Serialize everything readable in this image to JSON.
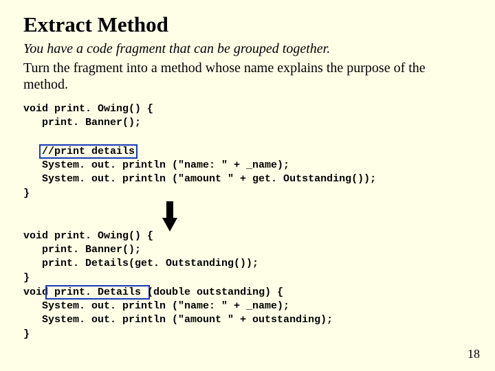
{
  "title": "Extract Method",
  "problem": "You have a code fragment that can be grouped together.",
  "solution": "Turn the fragment into a method whose name explains the purpose of the method.",
  "before": {
    "l1": "void print. Owing() {",
    "l2": "   print. Banner();",
    "l3": "",
    "l4a": "   ",
    "hl1": "//print details",
    "l5": "   System. out. println (\"name: \" + _name);",
    "l6": "   System. out. println (\"amount \" + get. Outstanding());",
    "l7": "}"
  },
  "after": {
    "l1": "void print. Owing() {",
    "l2": "   print. Banner();",
    "l3": "   print. Details(get. Outstanding());",
    "l4": "}",
    "l5a": "void",
    "hl2": " print. Details ",
    "l5b": "(double outstanding) {",
    "l6": "   System. out. println (\"name: \" + _name);",
    "l7": "   System. out. println (\"amount \" + outstanding);",
    "l8": "}"
  },
  "page": "18"
}
